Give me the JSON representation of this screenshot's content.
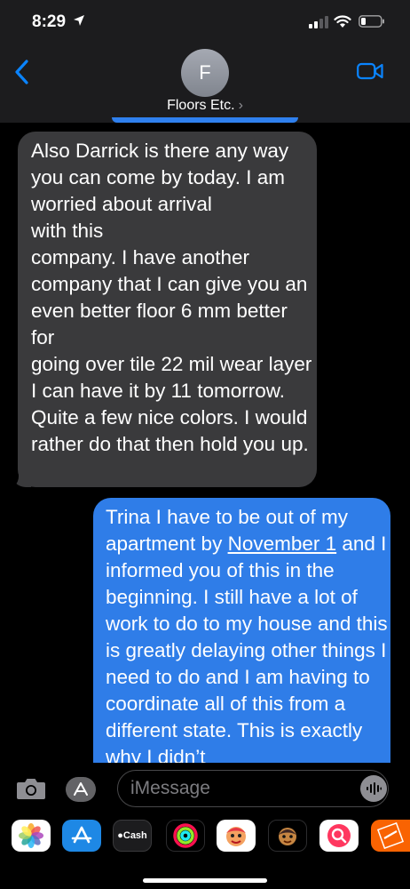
{
  "status_bar": {
    "time": "8:29"
  },
  "header": {
    "avatar_initial": "F",
    "contact_name": "Floors Etc."
  },
  "messages": {
    "incoming": {
      "text": "Also Darrick is there any way you can come by today. I am worried about arrival\nwith this\ncompany. I have another company that I can give you an even better floor 6 mm better for\ngoing over tile 22 mil wear layer I can have it by 11 tomorrow. Quite a few nice colors. I would rather do that then hold you up."
    },
    "outgoing": {
      "text_before_link": "Trina I have to be out of my apartment by ",
      "link": "November 1",
      "text_after_link": " and I informed you of this in the beginning. I still have a lot of work to do to my house and this is greatly delaying other things I need to do and I am having to coordinate all of this from a different state. This is exactly why I didn’t"
    }
  },
  "input_bar": {
    "placeholder": "iMessage"
  },
  "app_tray": {
    "apps": [
      {
        "name": "Photos",
        "icon": "photos-icon"
      },
      {
        "name": "App Store",
        "icon": "app-store-icon"
      },
      {
        "name": "Apple Cash",
        "icon": "apple-cash-icon",
        "label": "Cash"
      },
      {
        "name": "Fitness",
        "icon": "activity-rings-icon"
      },
      {
        "name": "Memoji",
        "icon": "memoji-icon"
      },
      {
        "name": "Memoji Stickers",
        "icon": "memoji-sticker-icon"
      },
      {
        "name": "Search Images",
        "icon": "image-search-icon"
      },
      {
        "name": "Home Depot",
        "icon": "home-depot-icon"
      }
    ]
  },
  "colors": {
    "incoming_bubble": "#3a3a3c",
    "outgoing_bubble": "#2f7de8",
    "header_bg": "#1c1c1e",
    "accent": "#0a84ff"
  }
}
